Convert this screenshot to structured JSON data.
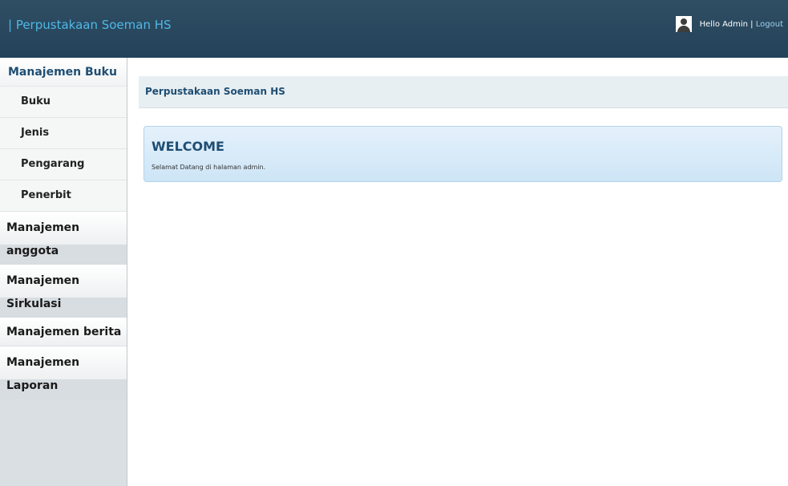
{
  "header": {
    "brand": "| Perpustakaan Soeman HS",
    "greeting": "Hello Admin |",
    "logout": "Logout"
  },
  "sidebar": {
    "book_mgmt": {
      "title": "Manajemen Buku",
      "items": [
        "Buku",
        "Jenis",
        "Pengarang",
        "Penerbit"
      ]
    },
    "member_mgmt": {
      "line1": "Manajemen",
      "line2": "anggota"
    },
    "circulation_mgmt": {
      "line1": "Manajemen",
      "line2": "Sirkulasi"
    },
    "news_mgmt": {
      "label": "Manajemen berita"
    },
    "report_mgmt": {
      "line1": "Manajemen",
      "line2": "Laporan"
    }
  },
  "main": {
    "breadcrumb": "Perpustakaan Soeman HS",
    "welcome_title": "WELCOME",
    "welcome_text": "Selamat Datang di halaman admin."
  },
  "colors": {
    "topbar": "#2b495e",
    "brand_text": "#4fb8e6",
    "heading_text": "#1f4e73",
    "sidebar_bg": "#d9dfe3",
    "welcome_bg": "#d6eaf8"
  },
  "icons": {
    "avatar": "user-avatar-icon"
  }
}
